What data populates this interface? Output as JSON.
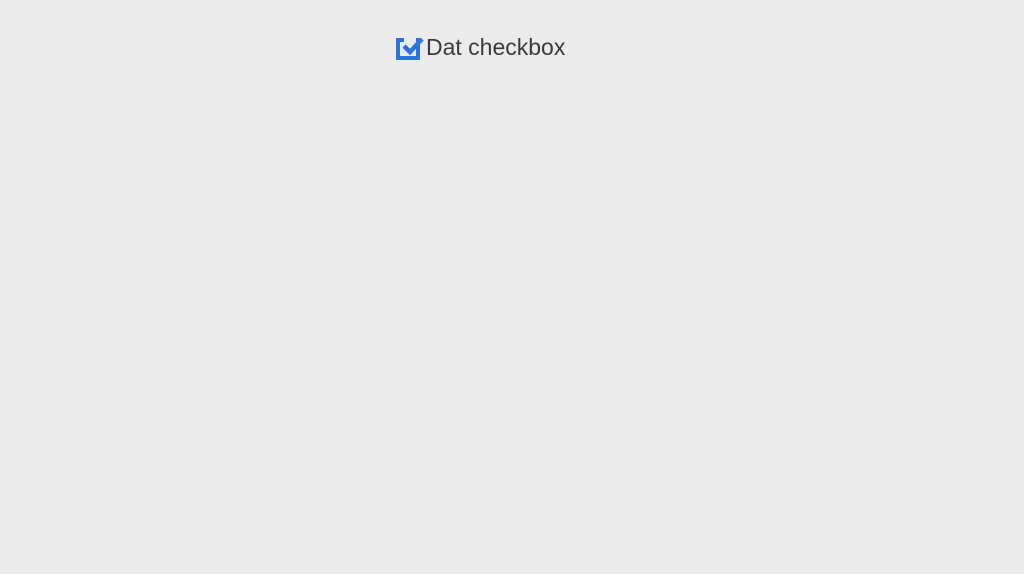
{
  "checkbox": {
    "label": "Dat checkbox",
    "checked": true
  }
}
